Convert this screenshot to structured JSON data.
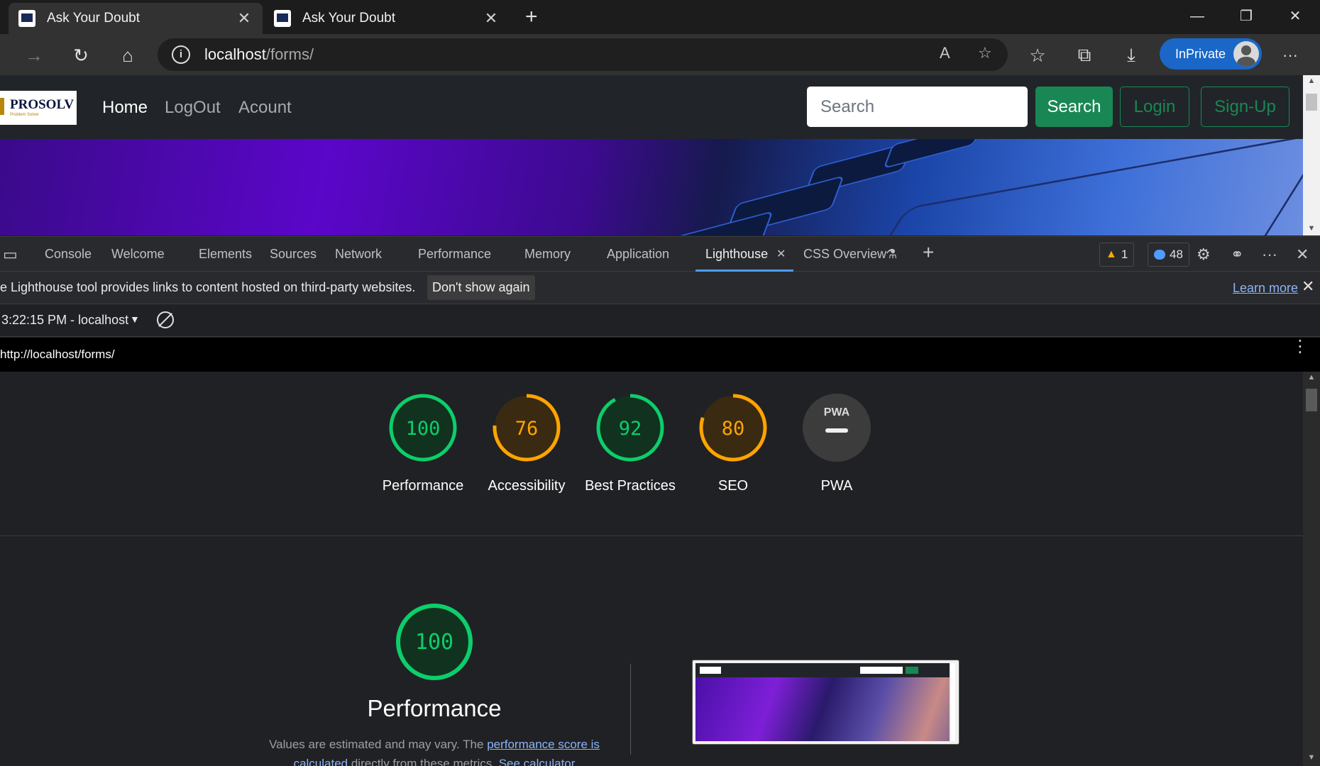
{
  "browser": {
    "tabs": [
      {
        "title": "Ask Your Doubt",
        "active": true
      },
      {
        "title": "Ask Your Doubt",
        "active": false
      }
    ],
    "new_tab": "+",
    "window_controls": {
      "minimize": "—",
      "restore": "❐",
      "close": "✕"
    },
    "address": {
      "host": "localhost",
      "path": "/forms/"
    },
    "inprivate_label": "InPrivate"
  },
  "site": {
    "brand": "PROSOLV",
    "brand_tagline": "Problem Solver",
    "nav": [
      "Home",
      "LogOut",
      "Acount"
    ],
    "search_placeholder": "Search",
    "search_button": "Search",
    "login_button": "Login",
    "signup_button": "Sign-Up"
  },
  "devtools": {
    "tabs": [
      "Console",
      "Welcome",
      "Elements",
      "Sources",
      "Network",
      "Performance",
      "Memory",
      "Application",
      "Lighthouse",
      "CSS Overview"
    ],
    "active_tab": "Lighthouse",
    "warnings_count": "1",
    "messages_count": "48",
    "infobar_message": "e Lighthouse tool provides links to content hosted on third-party websites.",
    "dont_show_again": "Don't show again",
    "learn_more": "Learn more",
    "report_selector": "3:22:15 PM - localhost",
    "report_url": "http://localhost/forms/"
  },
  "lighthouse": {
    "scores": [
      {
        "name": "Performance",
        "score": "100",
        "color": "#0cce6b"
      },
      {
        "name": "Accessibility",
        "score": "76",
        "color": "#ffa400"
      },
      {
        "name": "Best Practices",
        "score": "92",
        "color": "#0cce6b"
      },
      {
        "name": "SEO",
        "score": "80",
        "color": "#ffa400"
      },
      {
        "name": "PWA",
        "score": "—",
        "color": "#9aa0a6"
      }
    ],
    "pwa_badge": "PWA",
    "performance_section": {
      "score": "100",
      "title": "Performance",
      "desc_prefix": "Values are estimated and may vary. The ",
      "link1": "performance score is calculated",
      "desc_middle": " directly from these metrics. ",
      "link2": "See calculator"
    }
  }
}
